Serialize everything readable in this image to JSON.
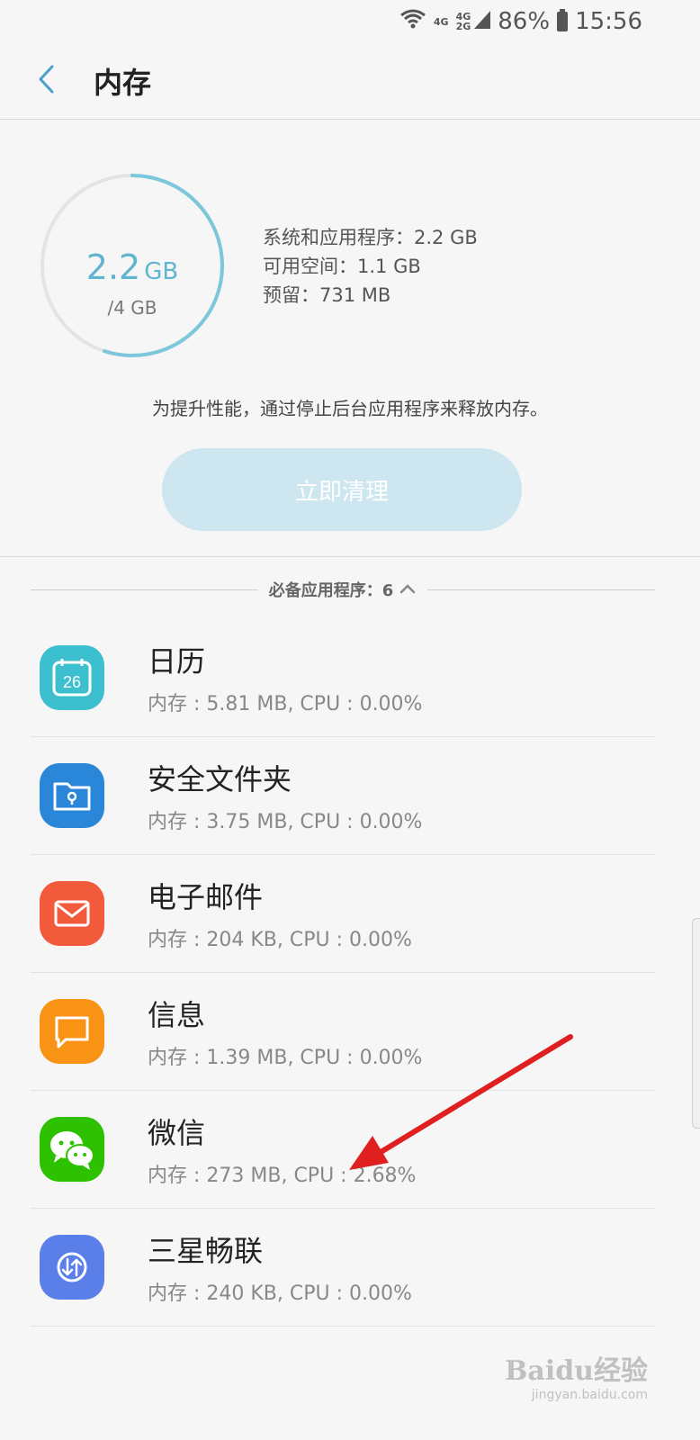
{
  "status_bar": {
    "net_top": "4G",
    "net_mid": "4G",
    "net_bottom": "2G",
    "battery": "86%",
    "time": "15:56"
  },
  "header": {
    "title": "内存",
    "back_icon": "chevron-left-icon"
  },
  "summary": {
    "used_value": "2.2",
    "used_unit": "GB",
    "total": "/4 GB",
    "used_fraction": 0.55,
    "stats": [
      "系统和应用程序：2.2 GB",
      "可用空间：1.1 GB",
      "预留：731 MB"
    ],
    "tip": "为提升性能，通过停止后台应用程序来释放内存。",
    "clean_button": "立即清理"
  },
  "section": {
    "label": "必备应用程序：6",
    "chevron_icon": "chevron-up-icon"
  },
  "apps": [
    {
      "name": "日历",
      "detail": "内存 : 5.81 MB, CPU : 0.00%",
      "icon": "calendar-icon",
      "icon_text": "26",
      "color": "#3cc0d0"
    },
    {
      "name": "安全文件夹",
      "detail": "内存 : 3.75 MB, CPU : 0.00%",
      "icon": "secure-folder-icon",
      "color": "#2a86d8"
    },
    {
      "name": "电子邮件",
      "detail": "内存 : 204 KB, CPU : 0.00%",
      "icon": "email-icon",
      "color": "#f25a3c"
    },
    {
      "name": "信息",
      "detail": "内存 : 1.39 MB, CPU : 0.00%",
      "icon": "message-icon",
      "color": "#f99316"
    },
    {
      "name": "微信",
      "detail": "内存 : 273 MB, CPU : 2.68%",
      "icon": "wechat-icon",
      "color": "#2dc100"
    },
    {
      "name": "三星畅联",
      "detail": "内存 : 240 KB, CPU : 0.00%",
      "icon": "samsung-connect-icon",
      "color": "#5b7fe8"
    }
  ],
  "watermark": {
    "brand": "Baidu经验",
    "url": "jingyan.baidu.com"
  },
  "colors": {
    "accent": "#5fb4cf",
    "button_bg": "#cde6ef",
    "arrow": "#e02020"
  }
}
